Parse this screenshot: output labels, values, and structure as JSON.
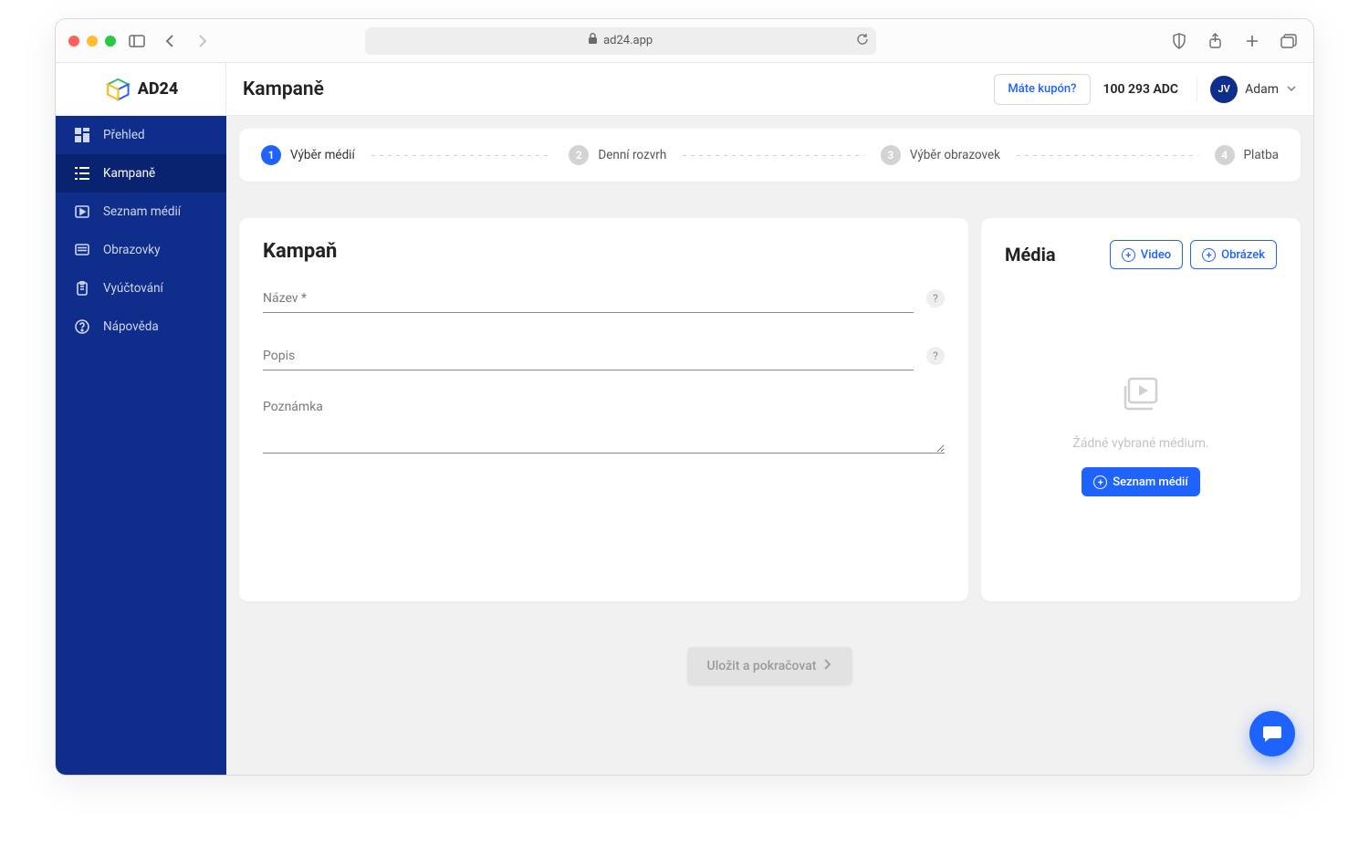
{
  "browser": {
    "url": "ad24.app"
  },
  "logo_text": "AD24",
  "sidebar": {
    "items": [
      {
        "label": "Přehled",
        "icon": "dashboard-icon"
      },
      {
        "label": "Kampaně",
        "icon": "list-icon"
      },
      {
        "label": "Seznam médií",
        "icon": "media-list-icon"
      },
      {
        "label": "Obrazovky",
        "icon": "screens-icon"
      },
      {
        "label": "Vyúčtování",
        "icon": "billing-icon"
      },
      {
        "label": "Nápověda",
        "icon": "help-icon"
      }
    ],
    "active_index": 1
  },
  "header": {
    "title": "Kampaně",
    "coupon_label": "Máte kupón?",
    "balance": "100 293 ADC",
    "user_initials": "JV",
    "user_name": "Adam"
  },
  "stepper": {
    "steps": [
      {
        "num": "1",
        "label": "Výběr médií",
        "active": true
      },
      {
        "num": "2",
        "label": "Denní rozvrh",
        "active": false
      },
      {
        "num": "3",
        "label": "Výběr obrazovek",
        "active": false
      },
      {
        "num": "4",
        "label": "Platba",
        "active": false
      }
    ]
  },
  "form": {
    "heading": "Kampaň",
    "name_label": "Název *",
    "name_value": "",
    "desc_label": "Popis",
    "desc_value": "",
    "note_label": "Poznámka",
    "note_value": ""
  },
  "media": {
    "heading": "Média",
    "video_label": "Video",
    "image_label": "Obrázek",
    "empty_text": "Žádné vybrané médium.",
    "list_label": "Seznam médií"
  },
  "save_label": "Uložit a pokračovat"
}
